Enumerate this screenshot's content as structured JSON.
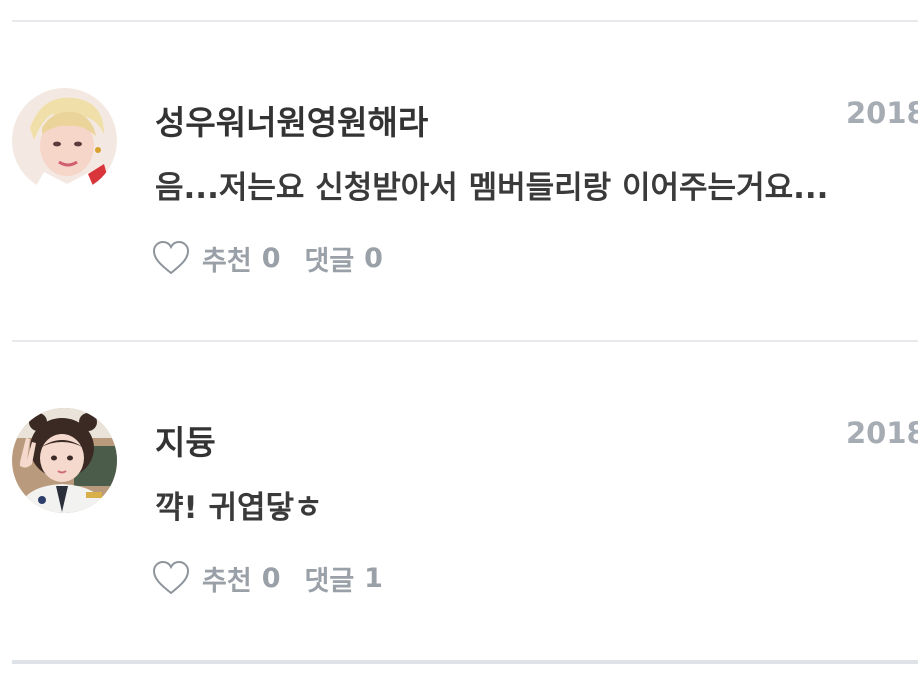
{
  "comments": [
    {
      "author": "성우워너원영원해라",
      "date": "2018",
      "text": "음...저는요 신청받아서 멤버들리랑 이어주는거요...",
      "like_label": "추천",
      "like_count": "0",
      "reply_label": "댓글",
      "reply_count": "0",
      "avatar": "user-photo-blonde"
    },
    {
      "author": "지듕",
      "date": "2018",
      "text": "꺅! 귀엽닿ㅎ",
      "like_label": "추천",
      "like_count": "0",
      "reply_label": "댓글",
      "reply_count": "1",
      "avatar": "user-photo-peace-sign"
    }
  ],
  "icons": {
    "like": "heart-outline-icon"
  },
  "colors": {
    "text_primary": "#333333",
    "text_meta": "#9aa0a7",
    "divider": "#e7e9ec"
  }
}
